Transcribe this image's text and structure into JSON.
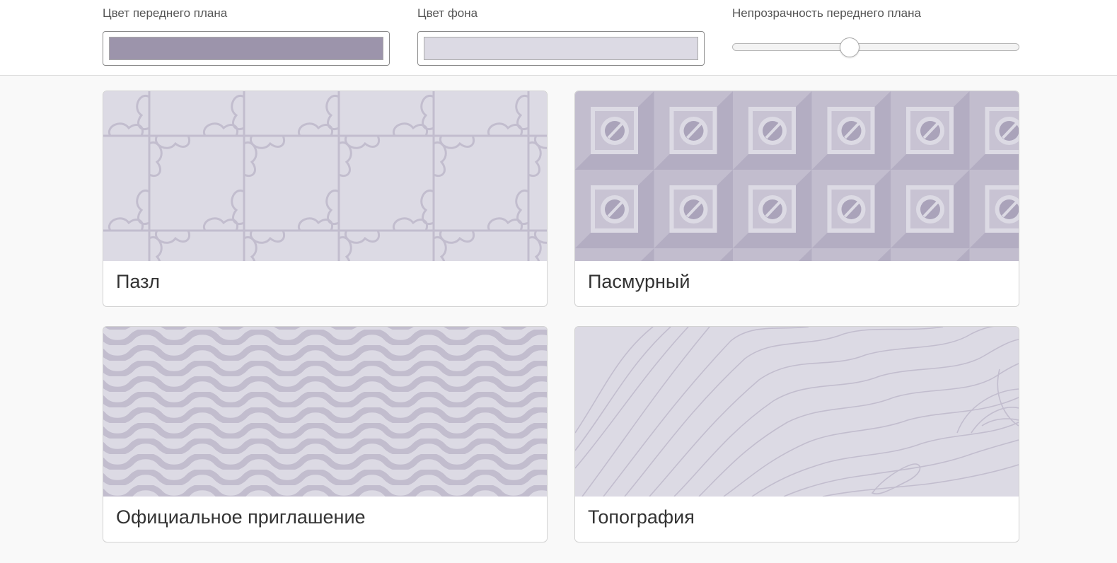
{
  "controls": {
    "foreground_label": "Цвет переднего плана",
    "foreground_color": "#9c94ab",
    "background_label": "Цвет фона",
    "background_color": "#dcdae4",
    "opacity_label": "Непрозрачность переднего плана",
    "opacity_value": 0.41
  },
  "patterns": [
    {
      "name": "Пазл",
      "icon": "puzzle-pattern"
    },
    {
      "name": "Пасмурный",
      "icon": "overcast-pattern"
    },
    {
      "name": "Официальное приглашение",
      "icon": "formal-invitation-pattern"
    },
    {
      "name": "Топография",
      "icon": "topography-pattern"
    }
  ]
}
